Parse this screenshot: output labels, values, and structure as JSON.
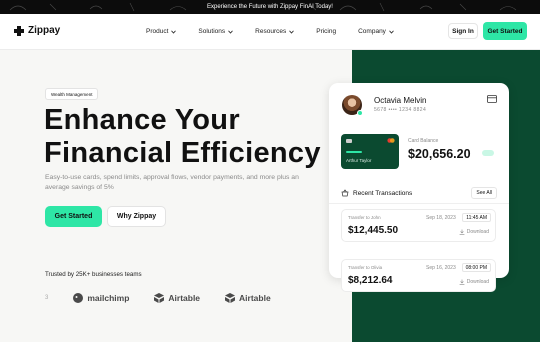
{
  "announcement": {
    "text": "Experience the Future with Zippay FinAI Today!"
  },
  "brand": {
    "name": "Zippay"
  },
  "nav": {
    "items": [
      {
        "label": "Product",
        "has_menu": true
      },
      {
        "label": "Solutions",
        "has_menu": true
      },
      {
        "label": "Resources",
        "has_menu": true
      },
      {
        "label": "Pricing",
        "has_menu": false
      },
      {
        "label": "Company",
        "has_menu": true
      }
    ],
    "sign_in": "Sign In",
    "get_started": "Get Started"
  },
  "hero": {
    "badge": "Wealth Management",
    "title_line1": "Enhance Your",
    "title_line2": "Financial Efficiency",
    "subtitle": "Easy-to-use cards, spend limits, approval flows, vendor payments, and more plus an average savings of 5%",
    "primary_cta": "Get Started",
    "secondary_cta": "Why Zippay",
    "trusted": "Trusted by 25K+ businesses teams",
    "logos": [
      "mailchimp",
      "Airtable",
      "Airtable"
    ]
  },
  "dashboard": {
    "user_name": "Octavia Melvin",
    "account": "5678  ••••  1234  8824",
    "card_holder": "Arthur Taylor",
    "balance_label": "Card Balance",
    "balance": "$20,656.20",
    "transactions_title": "Recent Transactions",
    "see_all": "See All",
    "transactions": [
      {
        "to": "Transfer to John",
        "date": "Sep 18, 2023",
        "time": "11:45 AM",
        "amount": "$12,445.50",
        "download": "Download"
      },
      {
        "to": "Transfer to Olivia",
        "date": "Sep 16, 2023",
        "time": "08:00 PM",
        "amount": "$8,212.64",
        "download": "Download"
      }
    ]
  },
  "colors": {
    "accent": "#2ee6a6",
    "dark_green": "#0b4a30",
    "background": "#f7f7f5"
  }
}
